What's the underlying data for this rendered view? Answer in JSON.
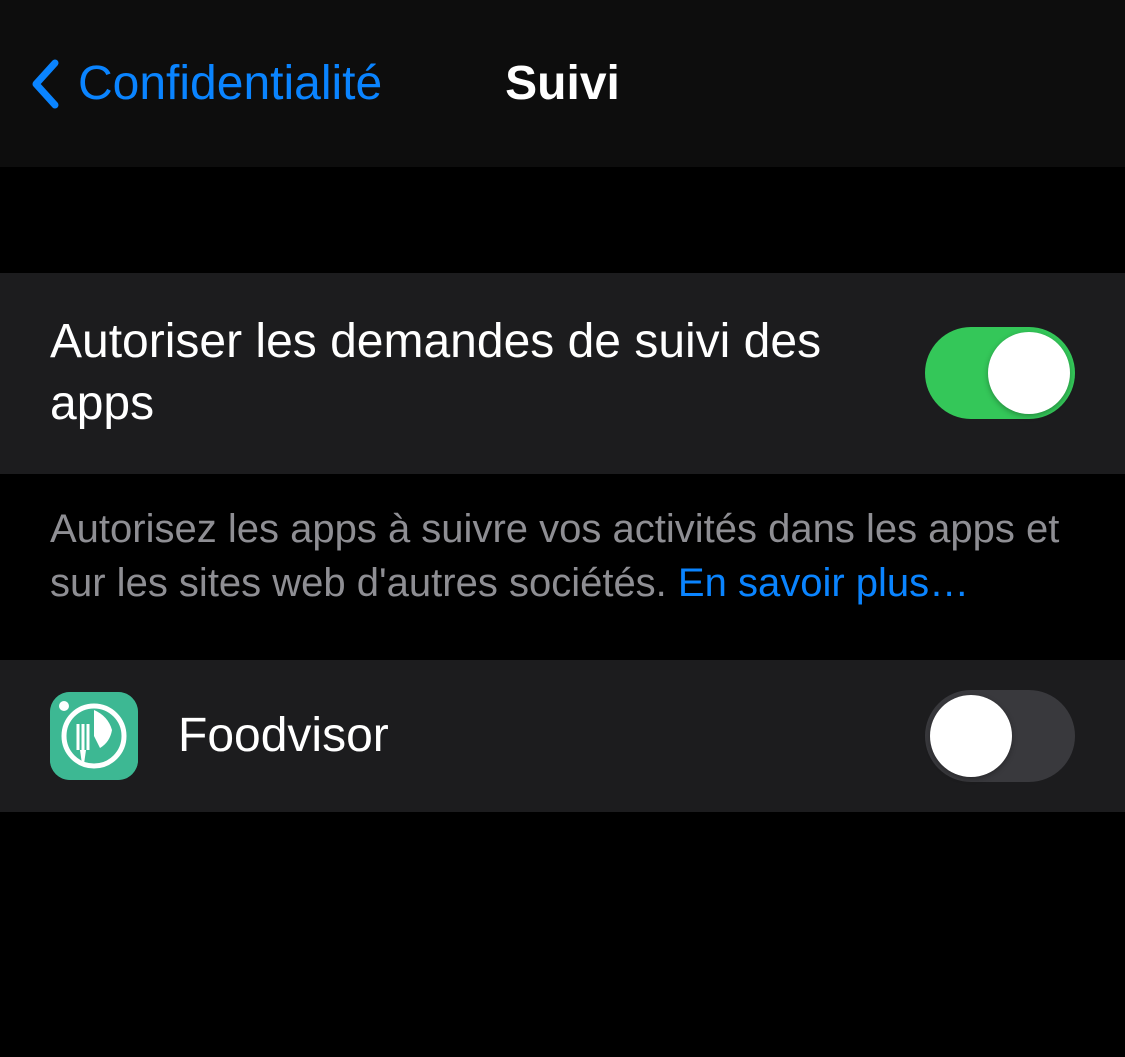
{
  "nav": {
    "back_label": "Confidentialité",
    "title": "Suivi"
  },
  "main_setting": {
    "label": "Autoriser les demandes de suivi des apps",
    "enabled": true
  },
  "footer": {
    "text": "Autorisez les apps à suivre vos activités dans les apps et sur les sites web d'autres sociétés. ",
    "link_text": "En savoir plus…"
  },
  "apps": [
    {
      "name": "Foodvisor",
      "icon": "foodvisor-icon",
      "enabled": false
    }
  ]
}
